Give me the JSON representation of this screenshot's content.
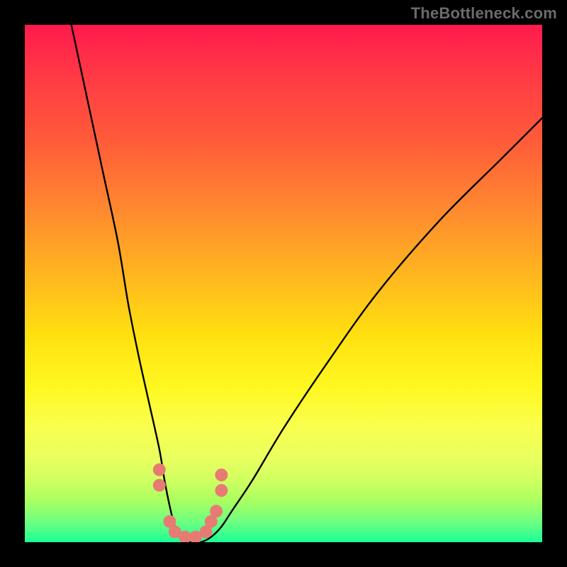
{
  "watermark": "TheBottleneck.com",
  "chart_data": {
    "type": "line",
    "title": "",
    "xlabel": "",
    "ylabel": "",
    "xlim": [
      0,
      100
    ],
    "ylim": [
      0,
      100
    ],
    "grid": false,
    "background_gradient": {
      "direction": "vertical_top_to_bottom",
      "stops": [
        {
          "pos": 0.0,
          "color": "#ff1a4d"
        },
        {
          "pos": 0.6,
          "color": "#ffe010"
        },
        {
          "pos": 1.0,
          "color": "#1aff96"
        }
      ]
    },
    "series": [
      {
        "name": "bottleneck-curve",
        "color": "#000000",
        "x": [
          9,
          12,
          15,
          18,
          20,
          22,
          24,
          26,
          27,
          28,
          29,
          30,
          32,
          34,
          36,
          38,
          40,
          44,
          50,
          58,
          68,
          80,
          92,
          100
        ],
        "y": [
          100,
          86,
          72,
          58,
          46,
          36,
          27,
          18,
          12,
          7,
          3,
          1,
          0,
          0,
          1,
          3,
          6,
          12,
          22,
          34,
          48,
          62,
          74,
          82
        ]
      }
    ],
    "annotations": [
      {
        "name": "valley-markers",
        "type": "scatter",
        "color": "#e77b73",
        "points": [
          {
            "x": 26,
            "y": 14
          },
          {
            "x": 26,
            "y": 11
          },
          {
            "x": 28,
            "y": 4
          },
          {
            "x": 29,
            "y": 2
          },
          {
            "x": 31,
            "y": 1
          },
          {
            "x": 33,
            "y": 1
          },
          {
            "x": 35,
            "y": 2
          },
          {
            "x": 36,
            "y": 4
          },
          {
            "x": 37,
            "y": 6
          },
          {
            "x": 38,
            "y": 10
          },
          {
            "x": 38,
            "y": 13
          }
        ]
      }
    ]
  }
}
